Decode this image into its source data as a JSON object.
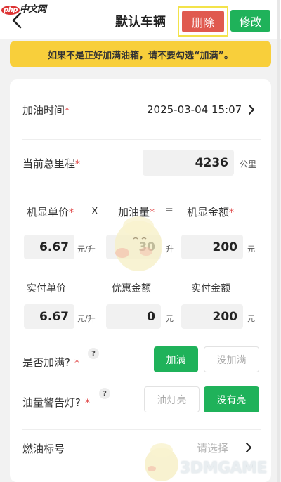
{
  "watermark_top": {
    "badge": "php",
    "text": "中文网"
  },
  "header": {
    "title": "默认车辆",
    "delete_label": "删除",
    "edit_label": "修改"
  },
  "notice": "如果不是正好加满油箱，请不要勾选“加满”。",
  "form": {
    "refuel_time": {
      "label": "加油时间",
      "required": "*",
      "value": "2025-03-04 15:07"
    },
    "odometer": {
      "label": "当前总里程",
      "required": "*",
      "value": "4236",
      "unit": "公里"
    },
    "calc_row1": {
      "price_label": "机显单价",
      "price_req": "*",
      "times": "X",
      "volume_label": "加油量",
      "volume_req": "*",
      "equals": "=",
      "amount_label": "机显金额",
      "amount_req": "*",
      "price_value": "6.67",
      "price_unit": "元/升",
      "volume_value": "30",
      "volume_unit": "升",
      "amount_value": "200",
      "amount_unit": "元"
    },
    "calc_row2": {
      "paid_price_label": "实付单价",
      "discount_label": "优惠金额",
      "paid_amount_label": "实付金额",
      "paid_price_value": "6.67",
      "paid_price_unit": "元/升",
      "discount_value": "0",
      "discount_unit": "元",
      "paid_amount_value": "200",
      "paid_amount_unit": "元"
    },
    "full_tank": {
      "label": "是否加满?",
      "required": "*",
      "help": "?",
      "option_yes": "加满",
      "option_no": "没加满"
    },
    "warning_light": {
      "label": "油量警告灯?",
      "required": "*",
      "help": "?",
      "option_on": "油灯亮",
      "option_off": "没有亮"
    },
    "fuel_grade": {
      "label": "燃油标号",
      "placeholder": "请选择"
    }
  },
  "watermark_bottom": "3DMGAME",
  "colors": {
    "primary": "#1fb25a",
    "danger": "#e05a4f",
    "notice": "#f8cf3b",
    "required": "#e04848"
  }
}
